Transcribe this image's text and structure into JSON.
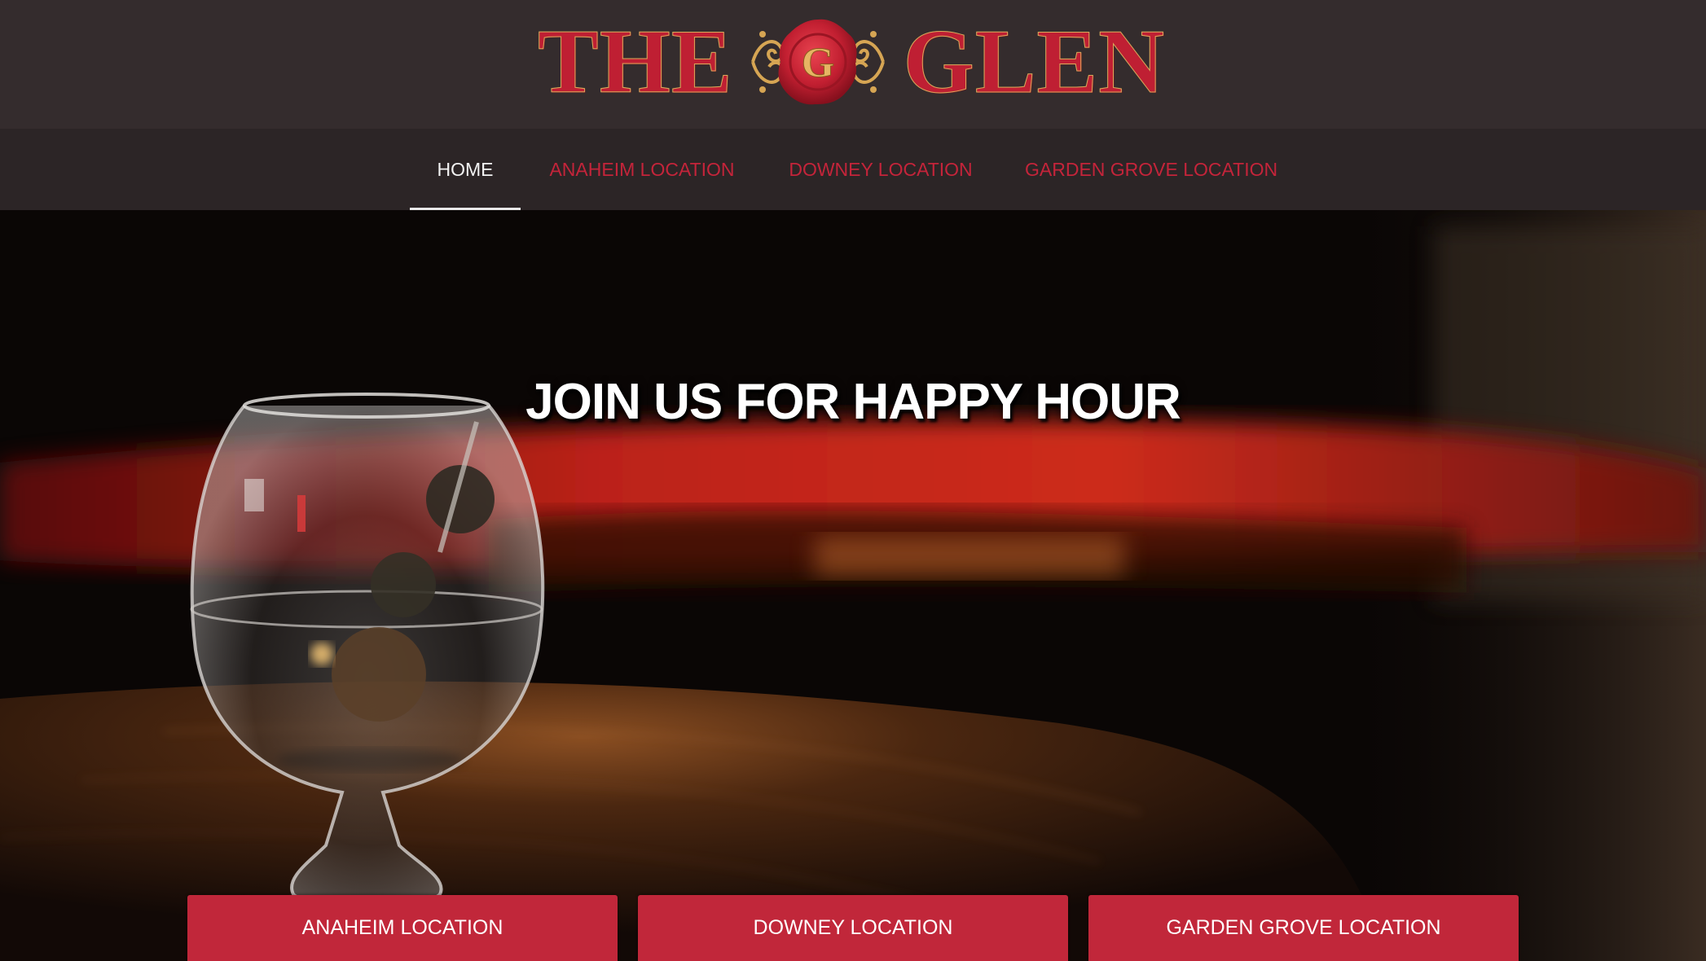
{
  "brand": {
    "word_left": "THE",
    "seal_letter": "G",
    "word_right": "GLEN",
    "primary_color": "#bf1f33",
    "gold_color": "#d8a85a"
  },
  "nav": {
    "items": [
      {
        "label": "HOME",
        "active": true
      },
      {
        "label": "ANAHEIM LOCATION",
        "active": false
      },
      {
        "label": "DOWNEY LOCATION",
        "active": false
      },
      {
        "label": "GARDEN GROVE LOCATION",
        "active": false
      }
    ]
  },
  "hero": {
    "title": "JOIN US FOR HAPPY HOUR",
    "buttons": [
      {
        "label": "ANAHEIM LOCATION"
      },
      {
        "label": "DOWNEY LOCATION"
      },
      {
        "label": "GARDEN GROVE LOCATION"
      }
    ],
    "button_color": "#c1273a"
  }
}
